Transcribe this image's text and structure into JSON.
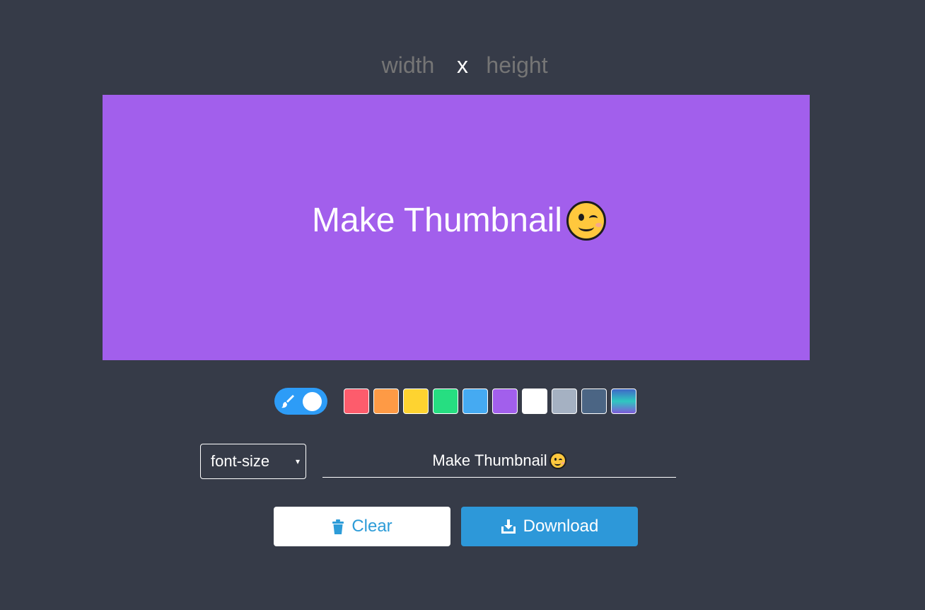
{
  "size": {
    "width_placeholder": "width",
    "separator": "x",
    "height_placeholder": "height"
  },
  "canvas": {
    "text": "Make Thumbnail",
    "emoji": "winking-face",
    "background": "#a25fec",
    "text_color": "#ffffff"
  },
  "toggle": {
    "icon": "brush-icon",
    "state": "on",
    "color": "#2d9cf7"
  },
  "palette": [
    {
      "name": "red",
      "color": "#fd5c6c"
    },
    {
      "name": "orange",
      "color": "#fe9a45"
    },
    {
      "name": "yellow",
      "color": "#fed330"
    },
    {
      "name": "green",
      "color": "#26de81"
    },
    {
      "name": "blue",
      "color": "#45aaf2"
    },
    {
      "name": "purple",
      "color": "#a25fec"
    },
    {
      "name": "white",
      "color": "#ffffff"
    },
    {
      "name": "gray",
      "color": "#a5b1c2"
    },
    {
      "name": "slate",
      "color": "#4b6584"
    },
    {
      "name": "gradient",
      "color": "gradient"
    }
  ],
  "font_size_select": {
    "label": "font-size",
    "caret": "▾"
  },
  "text_input": {
    "value": "Make Thumbnail"
  },
  "buttons": {
    "clear_label": "Clear",
    "clear_icon": "trash-icon",
    "download_label": "Download",
    "download_icon": "download-tray-icon"
  },
  "colors": {
    "page_bg": "#363b48",
    "accent": "#2d98d9"
  }
}
